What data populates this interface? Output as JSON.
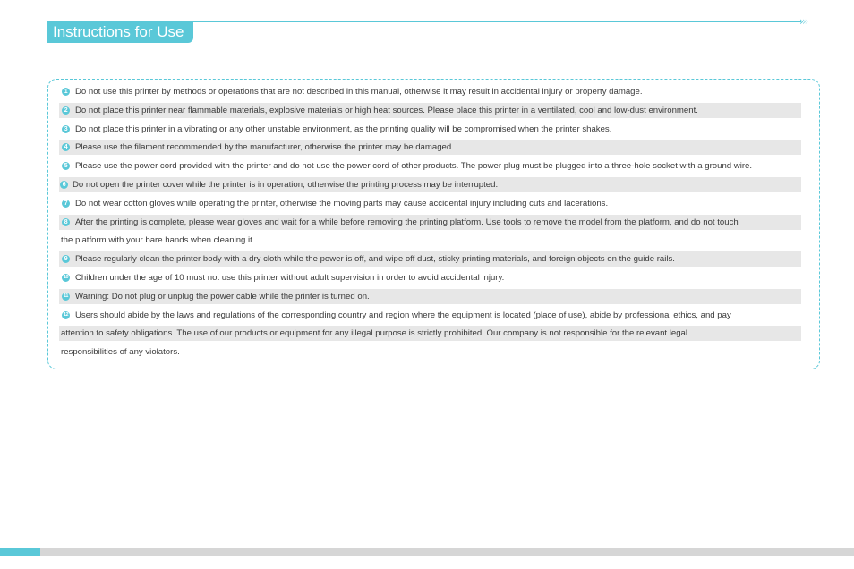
{
  "header": {
    "title": "Instructions for Use",
    "chevron_icon": "triple-chevron-right"
  },
  "colors": {
    "accent": "#5ac8d8",
    "row_shade": "#e7e7e7",
    "text": "#3a3a3a",
    "footer_bar": "#d6d6d6"
  },
  "instructions": [
    {
      "number": "1",
      "text": "Do not use this printer by methods or operations that are not described in this manual, otherwise it may result in accidental injury or property damage."
    },
    {
      "number": "2",
      "text": "Do not place this printer near flammable materials, explosive materials or high heat sources. Please place this printer in a ventilated, cool and low-dust environment."
    },
    {
      "number": "3",
      "text": "Do not place this printer in a vibrating or any other unstable environment, as the printing quality will be compromised when the printer shakes."
    },
    {
      "number": "4",
      "text": "Please use the filament recommended by the manufacturer, otherwise the printer may be damaged."
    },
    {
      "number": "5",
      "text": "Please use the power cord provided with the printer and do not use the power cord of other products. The power plug must be plugged into a three-hole socket with a ground wire."
    },
    {
      "number": "6",
      "text": "Do not open the printer cover while the printer is in operation, otherwise the printing process may be interrupted."
    },
    {
      "number": "7",
      "text": "Do not wear cotton gloves while operating the printer, otherwise the moving parts may cause accidental injury including cuts and lacerations."
    },
    {
      "number": "8",
      "text": "After the printing is complete, please wear gloves and wait for a while before removing the printing platform. Use tools to remove the model from the platform, and do not touch",
      "continuation": "the platform with your bare hands when cleaning it."
    },
    {
      "number": "9",
      "text": "Please regularly clean the printer body with a dry cloth while the power is off, and wipe off dust, sticky printing materials, and foreign objects on the guide rails."
    },
    {
      "number": "10",
      "text": "Children under the age of 10 must not use this printer without adult supervision in order to avoid accidental injury."
    },
    {
      "number": "11",
      "text": "Warning: Do not plug or unplug the power cable while the printer is turned on."
    },
    {
      "number": "12",
      "text": "Users should abide by the laws and regulations of the corresponding country and region where the equipment is located (place of use), abide by professional ethics, and pay",
      "continuation": "attention to safety obligations. The use of our products or equipment for any illegal purpose is strictly prohibited. Our company is not responsible for the relevant legal",
      "continuation2": "responsibilities of any violators."
    }
  ]
}
